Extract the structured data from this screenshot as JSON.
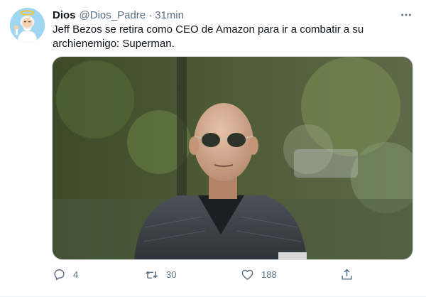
{
  "tweet": {
    "author_name": "Dios",
    "author_handle": "@Dios_Padre",
    "separator": "·",
    "timestamp": "31min",
    "text_lines": [
      "Jeff Bezos se retira como CEO de Amazon para ir a combatir a su",
      "archienemigo: Superman."
    ],
    "media_icon": "photo-of-bald-man-with-aviator-sunglasses-and-vest",
    "more_icon": "more-horizontal-icon"
  },
  "actions": {
    "reply": {
      "icon": "reply-icon",
      "count": "4"
    },
    "retweet": {
      "icon": "retweet-icon",
      "count": "30"
    },
    "like": {
      "icon": "like-icon",
      "count": "188"
    },
    "share": {
      "icon": "share-icon",
      "count": ""
    }
  },
  "colors": {
    "text_primary": "#0f1419",
    "text_secondary": "#5b7083",
    "avatar_bg": "#9fd6f2",
    "border": "#cfd9de"
  }
}
